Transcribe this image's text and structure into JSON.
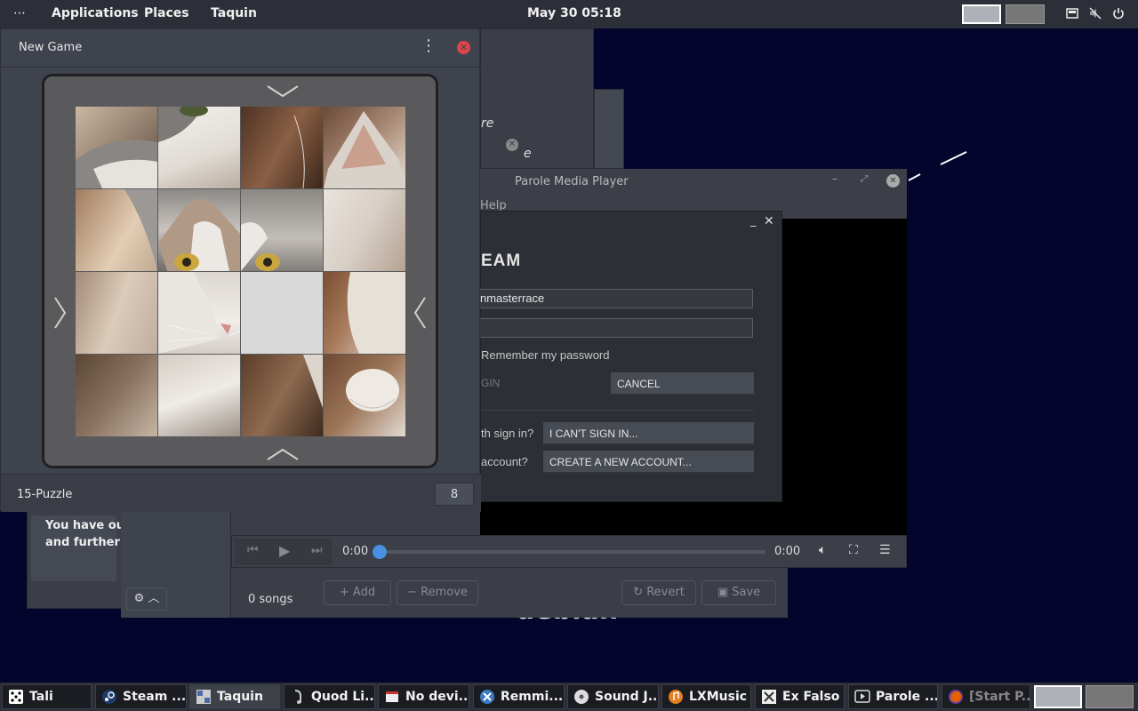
{
  "topbar": {
    "activities_icon": "dots-icon",
    "menus": [
      "Applications",
      "Places",
      "Taquin"
    ],
    "clock": "May 30  05:18",
    "tray_icons": [
      "network-icon",
      "muted-speaker-icon",
      "power-icon"
    ]
  },
  "background": {
    "frag1": "re",
    "frag2": "e",
    "music_text1": "You have our",
    "music_text2": "and further h",
    "songs": "0 songs",
    "add": "Add",
    "remove": "Remove",
    "revert": "Revert",
    "save": "Save",
    "debian": "debian"
  },
  "taquin": {
    "title": "New Game",
    "puzzle_type": "15-Puzzle",
    "moves": "8"
  },
  "parole": {
    "title": "Parole Media Player",
    "menu_help": "Help",
    "time_start": "0:00",
    "time_end": "0:00",
    "progress": 0
  },
  "steam": {
    "heading": "EAM",
    "username": "nmasterrace",
    "password": "",
    "remember": "Remember my password",
    "signin": "GIN",
    "cancel": "CANCEL",
    "trouble_label": "th sign in?",
    "cant_sign_in": "I CAN'T SIGN IN...",
    "account_label": "account?",
    "create_account": "CREATE A NEW ACCOUNT..."
  },
  "taskbar": [
    {
      "label": "Tali",
      "icon": "dice-icon"
    },
    {
      "label": "Steam ...",
      "icon": "steam-icon"
    },
    {
      "label": "Taquin",
      "icon": "taquin-icon"
    },
    {
      "label": "Quod Li...",
      "icon": "quodlibet-icon"
    },
    {
      "label": "No devi...",
      "icon": "device-icon"
    },
    {
      "label": "Remmi...",
      "icon": "remmina-icon"
    },
    {
      "label": "Sound J...",
      "icon": "soundjuicer-icon"
    },
    {
      "label": "LXMusic",
      "icon": "lxmusic-icon"
    },
    {
      "label": "Ex Falso",
      "icon": "exfalso-icon"
    },
    {
      "label": "Parole ...",
      "icon": "parole-icon"
    },
    {
      "label": "[Start P...",
      "icon": "firefox-icon"
    }
  ],
  "colors": {
    "desktop": "#04052c",
    "panel": "#2c2f37",
    "close": "#e0444b",
    "accent": "#4a90e2"
  }
}
